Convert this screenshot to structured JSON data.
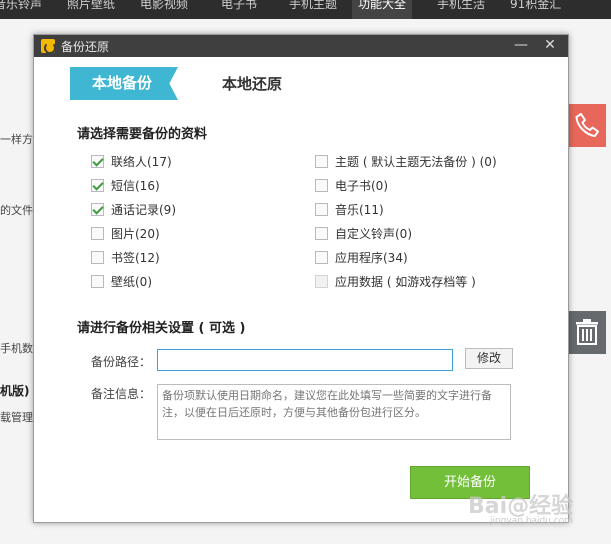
{
  "app": {
    "nav": [
      "音乐铃声",
      "照片壁纸",
      "电影视频",
      "电子书",
      "手机主题",
      "功能大全",
      "手机生活",
      "91积金汇"
    ],
    "active_nav": "功能大全",
    "bg_texts": [
      "一样方",
      "的文件",
      "手机数",
      "机版)",
      "载管理"
    ]
  },
  "dialog": {
    "title": "备份还原",
    "minimize_glyph": "—",
    "close_glyph": "✕",
    "tabs": {
      "active": "本地备份",
      "inactive": "本地还原"
    },
    "section1_title": "请选择需要备份的资料",
    "options_left": [
      {
        "label": "联络人(17)",
        "checked": true
      },
      {
        "label": "短信(16)",
        "checked": true
      },
      {
        "label": "通话记录(9)",
        "checked": true
      },
      {
        "label": "图片(20)",
        "checked": false
      },
      {
        "label": "书签(12)",
        "checked": false
      },
      {
        "label": "壁纸(0)",
        "checked": false
      }
    ],
    "options_right": [
      {
        "label": "主题 ( 默认主题无法备份 ) (0)",
        "checked": false
      },
      {
        "label": "电子书(0)",
        "checked": false
      },
      {
        "label": "音乐(11)",
        "checked": false
      },
      {
        "label": "自定义铃声(0)",
        "checked": false
      },
      {
        "label": "应用程序(34)",
        "checked": false
      },
      {
        "label": "应用数据 ( 如游戏存档等 )",
        "checked": false,
        "disabled": true
      }
    ],
    "section2_title": "请进行备份相关设置 ( 可选 )",
    "path_label": "备份路径：",
    "path_value": "",
    "modify_label": "修改",
    "note_label": "备注信息：",
    "note_placeholder": "备份项默认使用日期命名，建议您在此处填写一些简要的文字进行备注，以便在日后还原时，方便与其他备份包进行区分。",
    "start_label": "开始备份"
  },
  "watermark": {
    "main": "Bai@经验",
    "sub": "jingyan.baidu.com"
  },
  "colors": {
    "tab_accent": "#3fb6d2",
    "start_button": "#73bf3a",
    "titlebar": "#3f3f3f"
  }
}
